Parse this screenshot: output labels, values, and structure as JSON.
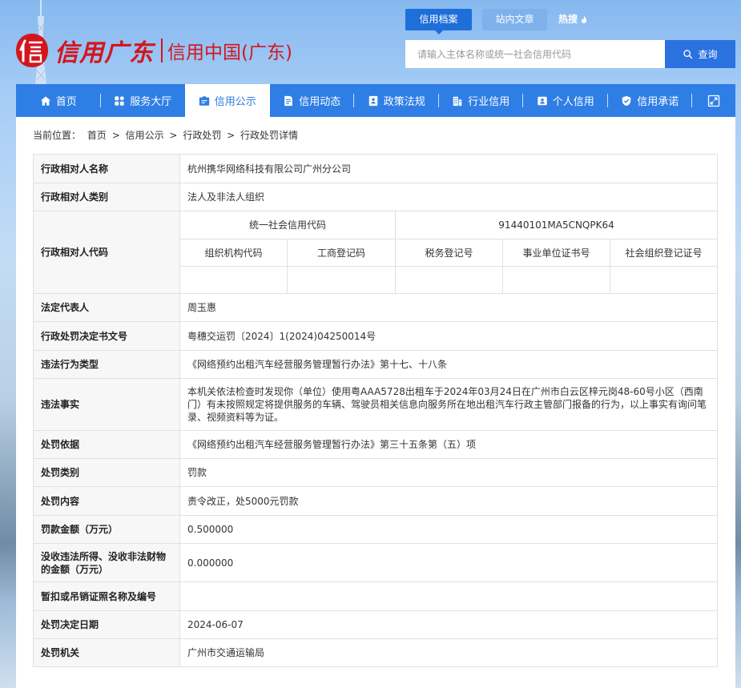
{
  "header": {
    "logo": {
      "brand": "信用广东",
      "site": "信用中国(广东)"
    },
    "search_tabs": [
      {
        "label": "信用档案",
        "active": true
      },
      {
        "label": "站内文章",
        "active": false
      },
      {
        "label": "热搜",
        "icon": "flame-icon",
        "active": false
      }
    ],
    "search": {
      "placeholder": "请输入主体名称或统一社会信用代码",
      "button_label": "查询",
      "icon": "search-icon"
    }
  },
  "nav": {
    "items": [
      {
        "label": "首页",
        "icon": "home-icon"
      },
      {
        "label": "服务大厅",
        "icon": "grid-icon"
      },
      {
        "label": "信用公示",
        "icon": "briefcase-icon"
      },
      {
        "label": "信用动态",
        "icon": "document-icon"
      },
      {
        "label": "政策法规",
        "icon": "book-icon"
      },
      {
        "label": "行业信用",
        "icon": "building-icon"
      },
      {
        "label": "个人信用",
        "icon": "id-card-icon"
      },
      {
        "label": "信用承诺",
        "icon": "shield-check-icon"
      }
    ],
    "active_index": 2,
    "expand_icon": "expand-icon"
  },
  "breadcrumb": {
    "prefix": "当前位置：",
    "separator": ">",
    "items": [
      "首页",
      "信用公示",
      "行政处罚",
      "行政处罚详情"
    ]
  },
  "detail": {
    "rows": [
      {
        "label": "行政相对人名称",
        "value": "杭州携华网络科技有限公司广州分公司"
      },
      {
        "label": "行政相对人类别",
        "value": "法人及非法人组织"
      },
      {
        "label": "法定代表人",
        "value": "周玉惠"
      },
      {
        "label": "行政处罚决定书文号",
        "value": "粤穗交运罚〔2024〕1(2024)04250014号"
      },
      {
        "label": "违法行为类型",
        "value": "《网络预约出租汽车经营服务管理暂行办法》第十七、十八条"
      },
      {
        "label": "违法事实",
        "value": "本机关依法检查时发现你（单位）使用粤AAA5728出租车于2024年03月24日在广州市白云区梓元岗48-60号小区（西南门）有未按照规定将提供服务的车辆、驾驶员相关信息向服务所在地出租汽车行政主管部门报备的行为，以上事实有询问笔录、视频资料等为证。"
      },
      {
        "label": "处罚依据",
        "value": "《网络预约出租汽车经营服务管理暂行办法》第三十五条第（五）项"
      },
      {
        "label": "处罚类别",
        "value": "罚款"
      },
      {
        "label": "处罚内容",
        "value": "责令改正，处5000元罚款"
      },
      {
        "label": "罚款金额（万元）",
        "value": "0.500000"
      },
      {
        "label": "没收违法所得、没收非法财物的金额（万元）",
        "value": "0.000000"
      },
      {
        "label": "暂扣或吊销证照名称及编号",
        "value": ""
      },
      {
        "label": "处罚决定日期",
        "value": "2024-06-07"
      },
      {
        "label": "处罚机关",
        "value": "广州市交通运输局"
      }
    ],
    "code": {
      "label": "行政相对人代码",
      "usc_label": "统一社会信用代码",
      "usc_value": "91440101MA5CNQPK64",
      "other_labels": [
        "组织机构代码",
        "工商登记码",
        "税务登记号",
        "事业单位证书号",
        "社会组织登记证号"
      ]
    }
  },
  "colors": {
    "nav_bg": "#2f7ee6",
    "active_search_tab": "#1e6fd9",
    "search_button": "#2a72df",
    "logo_red": "#d3161e",
    "label_bg": "#f7f7f7",
    "table_border": "#e1e1e1"
  }
}
